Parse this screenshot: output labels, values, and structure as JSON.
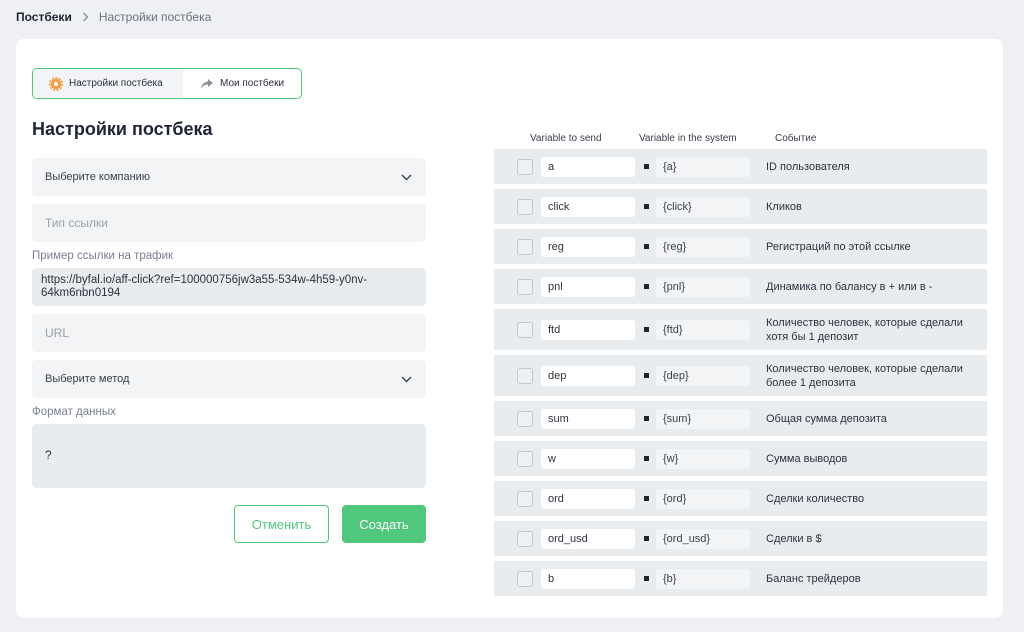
{
  "breadcrumb": {
    "root": "Постбеки",
    "current": "Настройки постбека"
  },
  "tabs": [
    {
      "label": "Настройки постбека",
      "icon": "gear-icon",
      "active": true
    },
    {
      "label": "Мои постбеки",
      "icon": "share-arrow-icon",
      "active": false
    }
  ],
  "page_title": "Настройки постбека",
  "form": {
    "company_select": "Выберите компанию",
    "link_type_placeholder": "Тип ссылки",
    "example_label": "Пример ссылки на трафик",
    "example_link": "https://byfal.io/aff-click?ref=100000756jw3a55-534w-4h59-y0nv-64km6nbn0194",
    "url_placeholder": "URL",
    "method_select": "Выберите метод",
    "data_format_label": "Формат данных",
    "data_format_value": "?",
    "cancel_label": "Отменить",
    "create_label": "Создать"
  },
  "variables": {
    "headers": {
      "send": "Variable to send",
      "system": "Variable in the system",
      "event": "Событие"
    },
    "rows": [
      {
        "send": "a",
        "system": "{a}",
        "event": "ID пользователя"
      },
      {
        "send": "click",
        "system": "{click}",
        "event": "Кликов"
      },
      {
        "send": "reg",
        "system": "{reg}",
        "event": "Регистраций по этой ссылке"
      },
      {
        "send": "pnl",
        "system": "{pnl}",
        "event": "Динамика по балансу в + или в -"
      },
      {
        "send": "ftd",
        "system": "{ftd}",
        "event": "Количество человек, которые сделали хотя бы 1 депозит"
      },
      {
        "send": "dep",
        "system": "{dep}",
        "event": "Количество человек, которые сделали более 1 депозита"
      },
      {
        "send": "sum",
        "system": "{sum}",
        "event": "Общая сумма депозита"
      },
      {
        "send": "w",
        "system": "{w}",
        "event": "Сумма выводов"
      },
      {
        "send": "ord",
        "system": "{ord}",
        "event": "Сделки количество"
      },
      {
        "send": "ord_usd",
        "system": "{ord_usd}",
        "event": "Сделки в $"
      },
      {
        "send": "b",
        "system": "{b}",
        "event": "Баланс трейдеров"
      }
    ]
  },
  "colors": {
    "accent": "#4fc87e",
    "background": "#eef0f3",
    "row": "#e9ecef"
  }
}
